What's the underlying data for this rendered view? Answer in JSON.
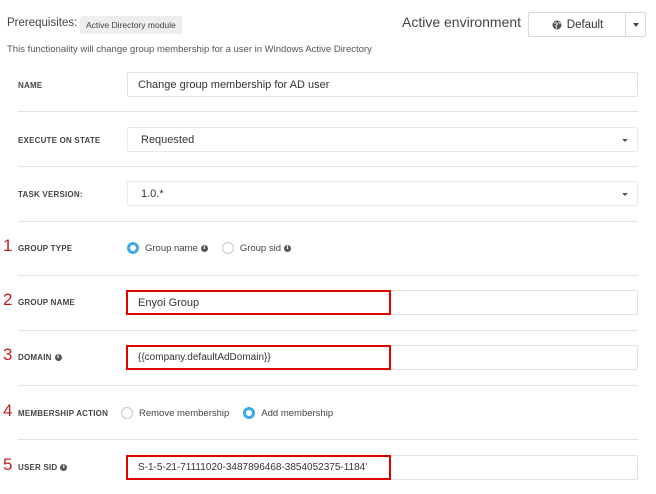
{
  "header": {
    "prereq_label": "Prerequisites:",
    "prereq_badge": "Active Directory module",
    "env_label": "Active environment",
    "env_value": "Default",
    "description": "This functionality will change group membership for a user in Windows Active Directory"
  },
  "form": {
    "name": {
      "label": "NAME",
      "value": "Change group membership for AD user"
    },
    "execute_on_state": {
      "label": "EXECUTE ON STATE",
      "value": "Requested"
    },
    "task_version": {
      "label": "TASK VERSION:",
      "value": "1.0.*"
    },
    "group_type": {
      "label": "GROUP TYPE",
      "options": [
        "Group name",
        "Group sid"
      ],
      "selected": "Group name"
    },
    "group_name": {
      "label": "GROUP NAME",
      "value": "Enyoi Group"
    },
    "domain": {
      "label": "DOMAIN",
      "value": "{{company.defaultAdDomain}}"
    },
    "membership_action": {
      "label": "MEMBERSHIP ACTION",
      "options": [
        "Remove membership",
        "Add membership"
      ],
      "selected": "Add membership"
    },
    "user_sid": {
      "label": "USER SID",
      "value": "S-1-5-21-71111020-3487896468-3854052375-1184'"
    }
  },
  "annotations": [
    "1",
    "2",
    "3",
    "4",
    "5"
  ],
  "colors": {
    "accent": "#3ea8e8",
    "highlight": "#e00000",
    "annotation": "#c21f1f"
  }
}
